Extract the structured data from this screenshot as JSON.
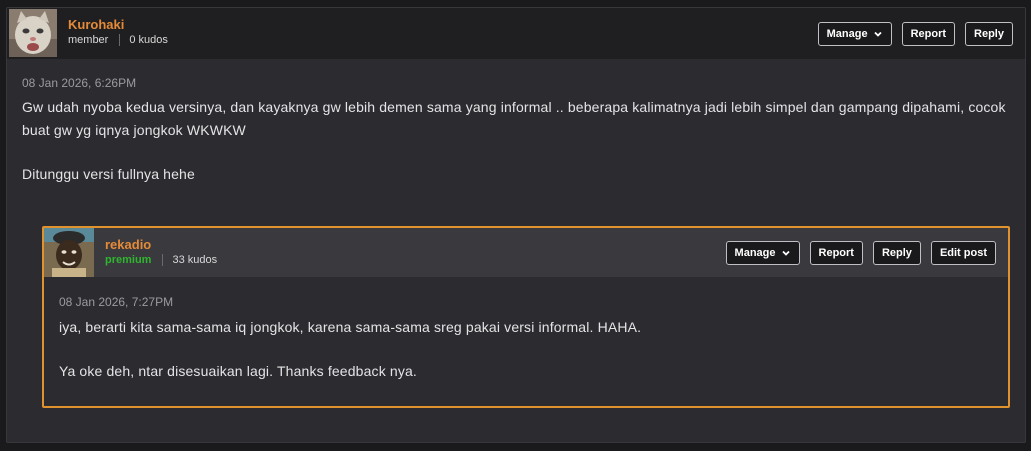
{
  "main_post": {
    "username": "Kurohaki",
    "role": "member",
    "kudos": "0 kudos",
    "buttons": {
      "manage": "Manage",
      "report": "Report",
      "reply": "Reply"
    },
    "timestamp": "08 Jan 2026, 6:26PM",
    "paragraphs": [
      "Gw udah nyoba kedua versinya, dan kayaknya gw lebih demen sama yang informal .. beberapa kalimatnya jadi lebih simpel dan gampang dipahami, cocok buat gw yg iqnya jongkok WKWKW",
      "Ditunggu versi fullnya hehe"
    ]
  },
  "reply_post": {
    "username": "rekadio",
    "role": "premium",
    "kudos": "33 kudos",
    "buttons": {
      "manage": "Manage",
      "report": "Report",
      "reply": "Reply",
      "edit": "Edit post"
    },
    "timestamp": "08 Jan 2026, 7:27PM",
    "paragraphs": [
      "iya, berarti kita sama-sama iq jongkok, karena sama-sama sreg pakai versi informal. HAHA.",
      "Ya oke deh, ntar disesuaikan lagi. Thanks feedback nya."
    ]
  },
  "colors": {
    "username": "#e58a37",
    "premium": "#2fb52f",
    "reply_border": "#e0922f"
  }
}
